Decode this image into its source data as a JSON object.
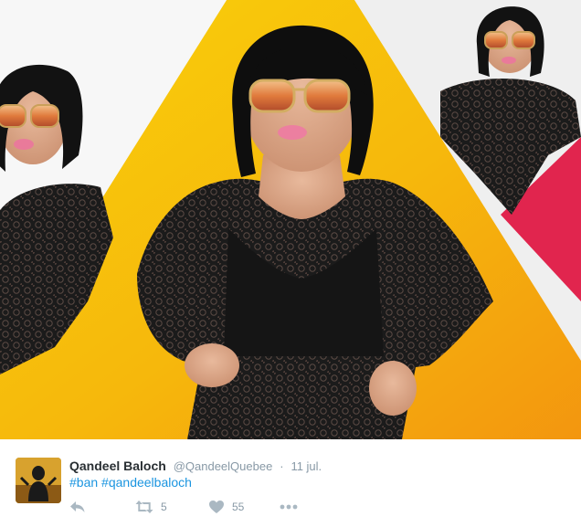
{
  "tweet": {
    "author": {
      "display_name": "Qandeel Baloch",
      "handle": "@QandeelQuebee"
    },
    "separator": "·",
    "timestamp": "11 jul.",
    "hashtags": [
      "#ban",
      "#qandeelbaloch"
    ],
    "media": {
      "colors": {
        "yellow": "#f7c400",
        "orange": "#f39a10",
        "magenta": "#e1254e",
        "background": "#ededed"
      }
    },
    "actions": {
      "reply_icon": "reply-icon",
      "retweet_icon": "retweet-icon",
      "retweet_count": "5",
      "like_icon": "heart-icon",
      "like_count": "55",
      "more_icon": "more-icon"
    }
  }
}
